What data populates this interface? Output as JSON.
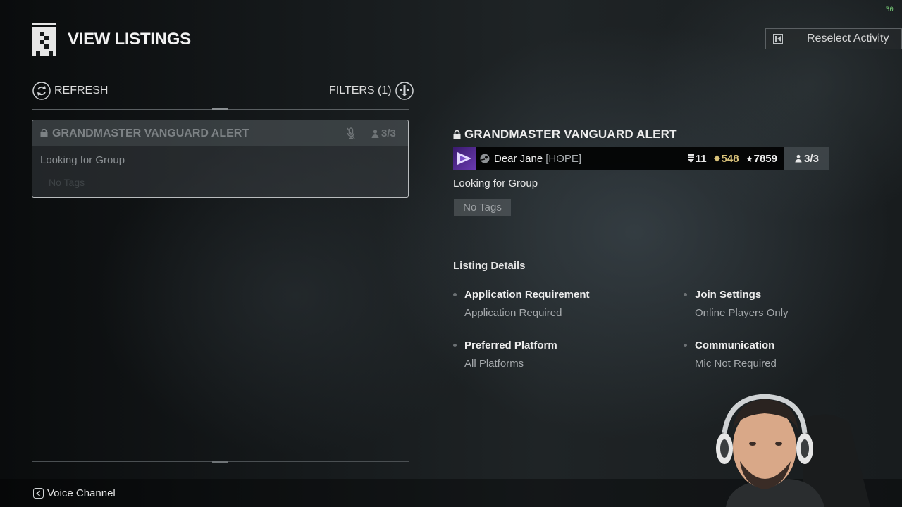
{
  "hud": {
    "fps": "30"
  },
  "header": {
    "title": "VIEW LISTINGS"
  },
  "actions": {
    "reselect_label": "Reselect Activity"
  },
  "toolbar": {
    "refresh_label": "REFRESH",
    "filters_label": "FILTERS (1)"
  },
  "listing_card": {
    "title": "GRANDMASTER VANGUARD ALERT",
    "count": "3/3",
    "description": "Looking for Group",
    "tags": "No Tags"
  },
  "detail": {
    "title": "GRANDMASTER VANGUARD ALERT",
    "player": {
      "name": "Dear Jane",
      "clan": "[HΘPE]",
      "guardian_rank": "11",
      "power": "548",
      "light": "7859"
    },
    "fireteam_count": "3/3",
    "description": "Looking for Group",
    "tag": "No Tags",
    "section_title": "Listing Details",
    "items": [
      {
        "key": "Application Requirement",
        "value": "Application Required"
      },
      {
        "key": "Join Settings",
        "value": "Online Players Only"
      },
      {
        "key": "Preferred Platform",
        "value": "All Platforms"
      },
      {
        "key": "Communication",
        "value": "Mic Not Required"
      }
    ]
  },
  "footer": {
    "voice_label": "Voice Channel"
  },
  "colors": {
    "power": "#d9c27a",
    "fps": "#7bd17b",
    "emblem": "#6a3ab0"
  }
}
